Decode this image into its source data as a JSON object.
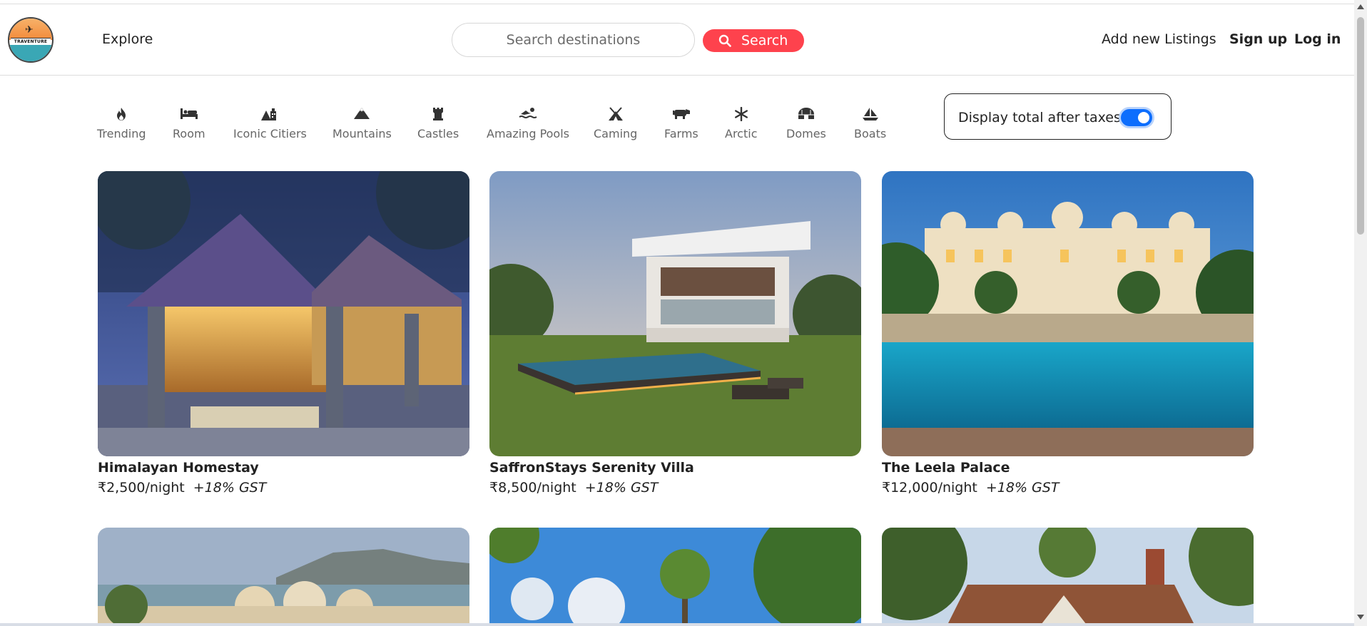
{
  "navbar": {
    "logo_text": "TRAVENTURE",
    "explore": "Explore",
    "search_placeholder": "Search destinations",
    "search_button": "Search",
    "add_listing": "Add new Listings",
    "signup": "Sign up",
    "login": "Log in",
    "accent_color": "#fe424d"
  },
  "filters": [
    {
      "icon": "fire-icon",
      "glyph": "🔥",
      "label": "Trending"
    },
    {
      "icon": "bed-icon",
      "glyph": "🛏",
      "label": "Room"
    },
    {
      "icon": "city-icon",
      "glyph": "🏙",
      "label": "Iconic Citiers"
    },
    {
      "icon": "mountain-icon",
      "glyph": "▲",
      "label": "Mountains"
    },
    {
      "icon": "castle-icon",
      "glyph": "♜",
      "label": "Castles"
    },
    {
      "icon": "swimmer-icon",
      "glyph": "🏊",
      "label": "Amazing Pools"
    },
    {
      "icon": "campground-icon",
      "glyph": "⛺",
      "label": "Caming"
    },
    {
      "icon": "cow-icon",
      "glyph": "🐄",
      "label": "Farms"
    },
    {
      "icon": "snowflake-icon",
      "glyph": "❄",
      "label": "Arctic"
    },
    {
      "icon": "igloo-icon",
      "glyph": "⌂",
      "label": "Domes"
    },
    {
      "icon": "sailboat-icon",
      "glyph": "⛵",
      "label": "Boats"
    }
  ],
  "tax_toggle": {
    "label": "Display total after taxes",
    "checked": true
  },
  "listings": [
    {
      "title": "Himalayan Homestay",
      "price": "₹2,500/night",
      "gst": "+18% GST"
    },
    {
      "title": "SaffronStays Serenity Villa",
      "price": "₹8,500/night",
      "gst": "+18% GST"
    },
    {
      "title": "The Leela Palace",
      "price": "₹12,000/night",
      "gst": "+18% GST"
    }
  ]
}
